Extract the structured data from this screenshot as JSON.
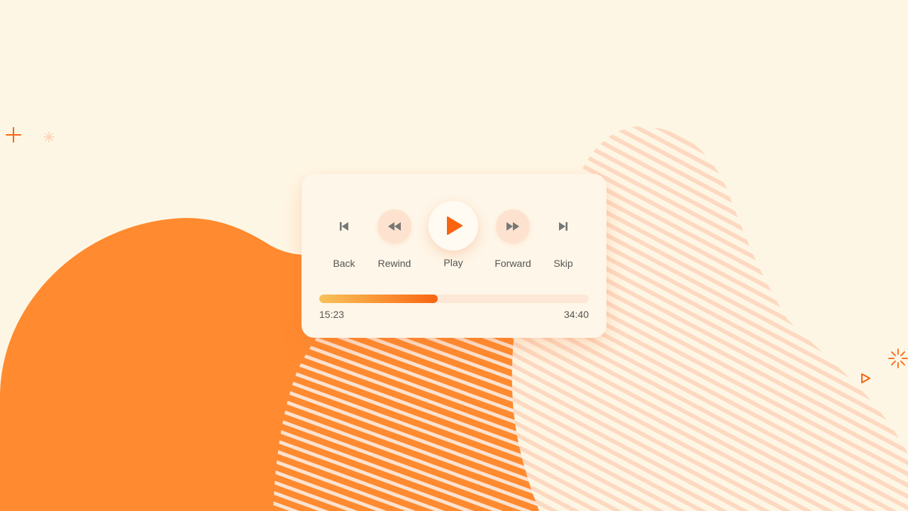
{
  "colors": {
    "background": "#fef6e4",
    "accent": "#f96412",
    "blob": "#ff8a2f",
    "stripes_light": "#fde0cc",
    "card": "#fef6e8"
  },
  "player": {
    "controls": [
      {
        "icon": "skip-back-icon",
        "label": "Back"
      },
      {
        "icon": "rewind-icon",
        "label": "Rewind"
      },
      {
        "icon": "play-icon",
        "label": "Play"
      },
      {
        "icon": "fast-forward-icon",
        "label": "Forward"
      },
      {
        "icon": "skip-forward-icon",
        "label": "Skip"
      }
    ],
    "progress": {
      "current_time": "15:23",
      "total_time": "34:40",
      "fraction": 0.44
    }
  },
  "decorations": {
    "icons": [
      "plus-icon",
      "sparkle-icon",
      "burst-icon",
      "triangle-outline-icon"
    ]
  }
}
